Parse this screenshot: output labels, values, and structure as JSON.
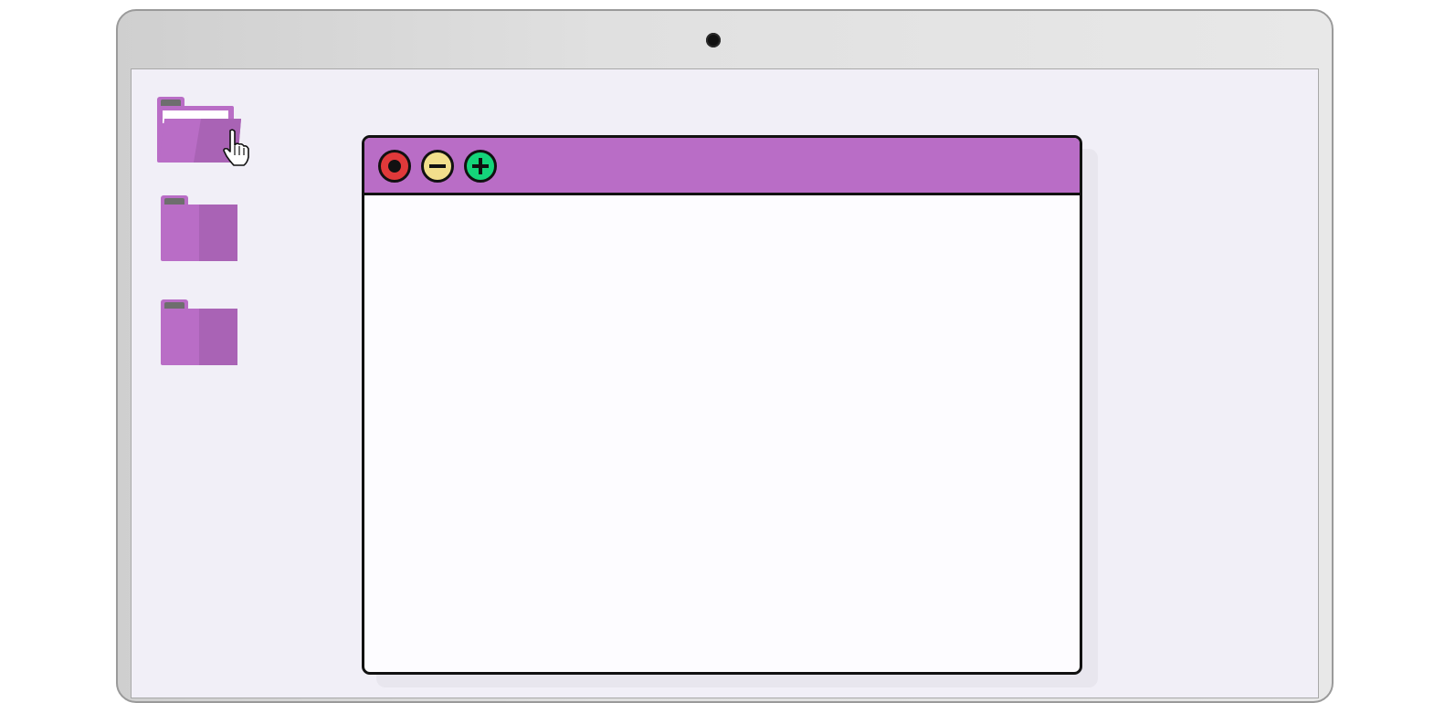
{
  "desktop": {
    "background_color": "#f1eff7",
    "folders": [
      {
        "icon": "folder-open-icon",
        "state": "open",
        "color": "#b96dc6"
      },
      {
        "icon": "folder-icon",
        "state": "closed",
        "color": "#b96dc6"
      },
      {
        "icon": "folder-icon",
        "state": "closed",
        "color": "#b96dc6"
      }
    ],
    "cursor": {
      "icon": "hand-pointer-icon",
      "hovering": "folder-1"
    }
  },
  "window": {
    "titlebar_color": "#b96dc6",
    "body_color": "#fdfcff",
    "controls": [
      {
        "icon": "close-icon",
        "color": "#e0393a"
      },
      {
        "icon": "minimize-icon",
        "color": "#f2df8c"
      },
      {
        "icon": "maximize-icon",
        "color": "#14d47a"
      }
    ]
  },
  "device": {
    "frame_icon": "laptop-frame",
    "camera_icon": "camera-icon"
  }
}
